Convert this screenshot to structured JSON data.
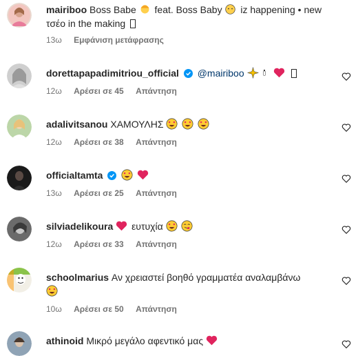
{
  "caption": {
    "username": "mairiboo",
    "text_before": "Boss Babe",
    "text_middle": "feat. Boss Baby",
    "text_after": "iz happening • new",
    "text_line2": "τσέο in the making",
    "time": "13ω",
    "translate": "Εμφάνιση μετάφρασης"
  },
  "comments": [
    {
      "username": "dorettapapadimitriou_official",
      "verified": true,
      "mention": "@mairiboo",
      "text": "",
      "time": "12ω",
      "likes": "Αρέσει σε 45",
      "reply": "Απάντηση"
    },
    {
      "username": "adalivitsanou",
      "verified": false,
      "text": "ΧΑΜΟΥΛΗΣ",
      "time": "12ω",
      "likes": "Αρέσει σε 38",
      "reply": "Απάντηση"
    },
    {
      "username": "officialtamta",
      "verified": true,
      "text": "",
      "time": "13ω",
      "likes": "Αρέσει σε 25",
      "reply": "Απάντηση"
    },
    {
      "username": "silviadelikoura",
      "verified": false,
      "text": "ευτυχία",
      "time": "12ω",
      "likes": "Αρέσει σε 33",
      "reply": "Απάντηση"
    },
    {
      "username": "schoolmarius",
      "verified": false,
      "text": "Αν χρειαστεί βοηθό γραμματέα αναλαμβάνω",
      "time": "10ω",
      "likes": "Αρέσει σε 50",
      "reply": "Απάντηση"
    },
    {
      "username": "athinoid",
      "verified": false,
      "text": "Μικρό μεγάλο αφεντικό μας",
      "time": "",
      "likes": "",
      "reply": ""
    }
  ],
  "icons": {
    "heart_outline": "heart-outline-icon",
    "heart_emoji": "red-heart-emoji",
    "heart_eyes": "heart-eyes-emoji",
    "verified": "verified-badge-icon"
  },
  "colors": {
    "text": "#262626",
    "meta": "#737373",
    "mention": "#00376b",
    "verified": "#0095f6",
    "heart": "#e0245e",
    "emoji_face": "#ffcc33"
  }
}
